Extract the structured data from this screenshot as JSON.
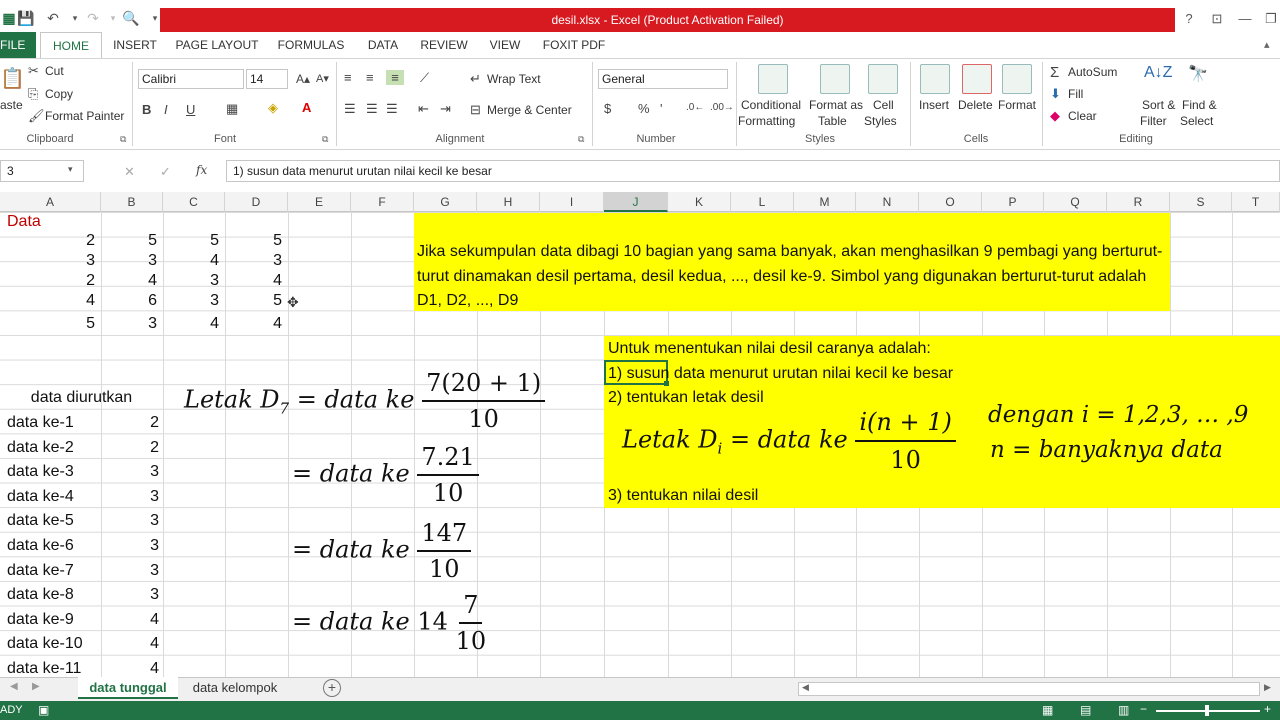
{
  "window": {
    "title": "desil.xlsx - Excel (Product Activation Failed)",
    "help": "?"
  },
  "tabs": [
    "FILE",
    "HOME",
    "INSERT",
    "PAGE LAYOUT",
    "FORMULAS",
    "DATA",
    "REVIEW",
    "VIEW",
    "FOXIT PDF"
  ],
  "ribbon": {
    "clipboard": {
      "paste": "aste",
      "cut": "Cut",
      "copy": "Copy",
      "format_painter": "Format Painter",
      "label": "Clipboard"
    },
    "font": {
      "name": "Calibri",
      "size": "14",
      "bold": "B",
      "italic": "I",
      "underline": "U",
      "label": "Font"
    },
    "alignment": {
      "wrap": "Wrap Text",
      "merge": "Merge & Center",
      "label": "Alignment"
    },
    "number": {
      "format": "General",
      "label": "Number",
      "currency": "$",
      "percent": "%",
      "comma": "'"
    },
    "styles": {
      "cond1": "Conditional",
      "cond2": "Formatting",
      "table1": "Format as",
      "table2": "Table",
      "cell1": "Cell",
      "cell2": "Styles",
      "label": "Styles"
    },
    "cells": {
      "insert": "Insert",
      "delete": "Delete",
      "format": "Format",
      "label": "Cells"
    },
    "editing": {
      "autosum": "AutoSum",
      "fill": "Fill",
      "clear": "Clear",
      "sort1": "Sort &",
      "sort2": "Filter",
      "find1": "Find &",
      "find2": "Select",
      "label": "Editing"
    }
  },
  "formula_bar": {
    "name_box": "3",
    "fx": "fx",
    "content": "1) susun data menurut urutan nilai kecil ke besar"
  },
  "columns": [
    "A",
    "B",
    "C",
    "D",
    "E",
    "F",
    "G",
    "H",
    "I",
    "J",
    "K",
    "L",
    "M",
    "N",
    "O",
    "P",
    "Q",
    "R",
    "S",
    "T"
  ],
  "data_header": "Data",
  "data_rows": [
    [
      "2",
      "5",
      "5",
      "5"
    ],
    [
      "3",
      "3",
      "4",
      "3"
    ],
    [
      "2",
      "4",
      "3",
      "4"
    ],
    [
      "4",
      "6",
      "3",
      "5"
    ],
    [
      "5",
      "3",
      "4",
      "4"
    ]
  ],
  "sorted_header": "data diurutkan",
  "sorted": [
    [
      "data ke-1",
      "2"
    ],
    [
      "data ke-2",
      "2"
    ],
    [
      "data ke-3",
      "3"
    ],
    [
      "data ke-4",
      "3"
    ],
    [
      "data ke-5",
      "3"
    ],
    [
      "data ke-6",
      "3"
    ],
    [
      "data ke-7",
      "3"
    ],
    [
      "data ke-8",
      "3"
    ],
    [
      "data ke-9",
      "4"
    ],
    [
      "data ke-10",
      "4"
    ],
    [
      "data ke-11",
      "4"
    ]
  ],
  "definition": "Jika sekumpulan data dibagi 10 bagian yang sama banyak, akan menghasilkan 9 pembagi yang berturut-turut dinamakan desil pertama, desil kedua, ..., desil ke-9. Simbol yang digunakan berturut-turut adalah D1, D2, ..., D9",
  "steps": {
    "intro": "Untuk menentukan nilai desil caranya adalah:",
    "s1a": "1) susun",
    "s1b": " data menurut urutan nilai kecil ke besar",
    "s2": "2) tentukan letak desil",
    "s3": "3) tentukan nilai desil"
  },
  "formula_general": {
    "lhs": "Letak D",
    "sub": "i",
    "mid": " = data ke ",
    "num": "i(n + 1)",
    "den": "10",
    "cond1": "dengan i = 1,2,3, … ,9",
    "cond2": "n = banyaknya data"
  },
  "calc": {
    "lhs": "Letak D",
    "sub": "7",
    "eq": " = data ke ",
    "f1n": "7(20 + 1)",
    "f1d": "10",
    "f2n": "7.21",
    "f2d": "10",
    "f3n": "147",
    "f3d": "10",
    "mixed_whole": "14",
    "f4n": "7",
    "f4d": "10"
  },
  "sheets": [
    "data tunggal",
    "data kelompok"
  ],
  "status": {
    "ready": "ADY"
  }
}
